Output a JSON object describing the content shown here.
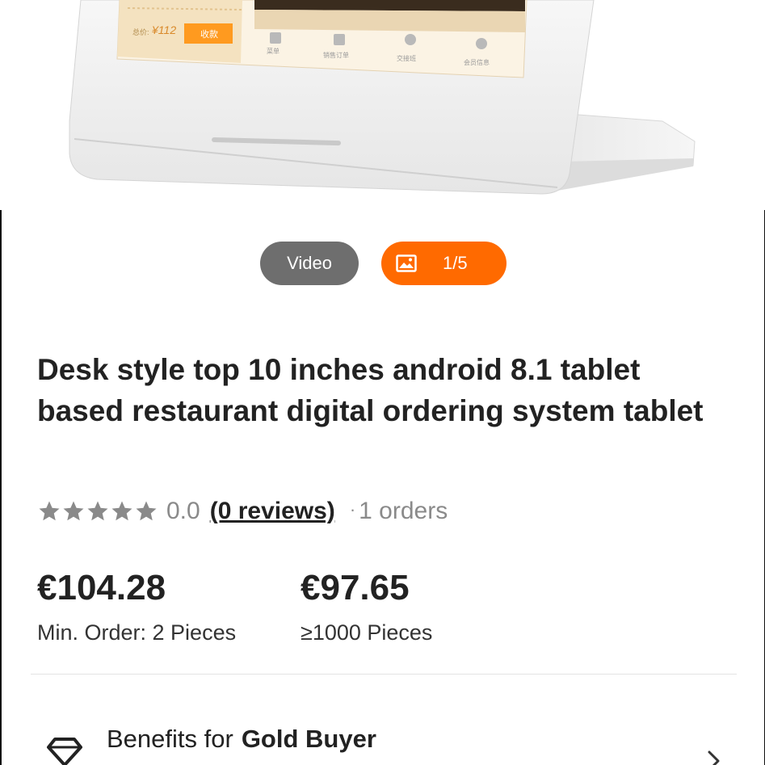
{
  "product_image": {
    "alt": "",
    "screen": {
      "total_label": "总价:",
      "total_value": "¥112",
      "pay_button": "收款",
      "nav_items": [
        "菜单",
        "销售订单",
        "交接班",
        "会员信息"
      ]
    }
  },
  "media": {
    "video_label": "Video",
    "photo_counter": "1/5",
    "photo_icon": "image-icon"
  },
  "product": {
    "title": "Desk style top 10 inches android 8.1  tablet based  restaurant digital ordering system tablet",
    "rating_value": "0.0",
    "reviews_link": "(0 reviews)",
    "orders_dot": "·",
    "orders": "1 orders",
    "stars_filled": 0,
    "stars_total": 5
  },
  "pricing": [
    {
      "price": "€104.28",
      "condition": "Min. Order: 2 Pieces"
    },
    {
      "price": "€97.65",
      "condition": "≥1000 Pieces"
    }
  ],
  "benefits": {
    "prefix": "Benefits for",
    "tier": "Gold Buyer",
    "icon": "diamond-icon"
  },
  "colors": {
    "accent": "#ff6a00",
    "video_pill": "#6e6e6e",
    "star": "#8a8a8a"
  }
}
